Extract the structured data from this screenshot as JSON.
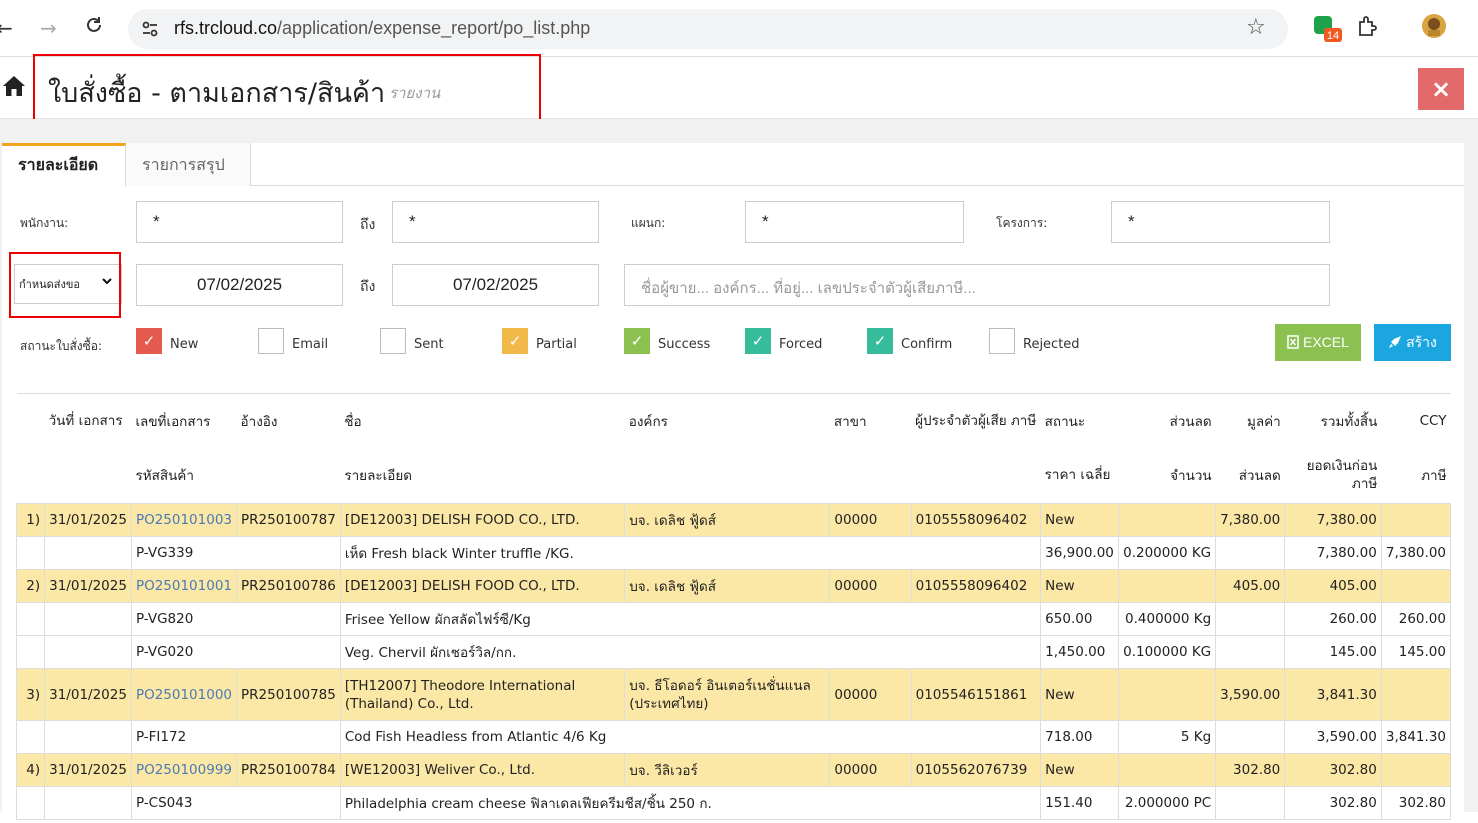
{
  "browser": {
    "url_domain": "rfs.trcloud.co",
    "url_path": "/application/expense_report/po_list.php",
    "ext_badge": "14"
  },
  "page": {
    "title": "ใบสั่งซื้อ - ตามเอกสาร/สินค้า",
    "subtitle": "รายงาน",
    "close_label": "×"
  },
  "tabs": [
    "รายละเอียด",
    "รายการสรุป"
  ],
  "filters": {
    "employee_label": "พนักงาน:",
    "employee_value": "*",
    "to_label_1": "ถึง",
    "employee_to_value": "*",
    "dept_label": "แผนก:",
    "dept_value": "*",
    "project_label": "โครงการ:",
    "project_value": "*",
    "date_type": "กำหนดส่งขอ",
    "date_from": "07/02/2025",
    "to_label_2": "ถึง",
    "date_to": "07/02/2025",
    "search_placeholder": "ชื่อผู้ขาย... องค์กร... ที่อยู่... เลขประจำตัวผู้เสียภาษี...",
    "status_label": "สถานะใบสั่งซื้อ:"
  },
  "statuses": [
    {
      "label": "New",
      "checked": true,
      "color": "#e55a4e"
    },
    {
      "label": "Email",
      "checked": false,
      "color": "#ffffff"
    },
    {
      "label": "Sent",
      "checked": false,
      "color": "#ffffff"
    },
    {
      "label": "Partial",
      "checked": true,
      "color": "#f0b94a"
    },
    {
      "label": "Success",
      "checked": true,
      "color": "#8cc152"
    },
    {
      "label": "Forced",
      "checked": true,
      "color": "#37bc9b"
    },
    {
      "label": "Confirm",
      "checked": true,
      "color": "#37bc9b"
    },
    {
      "label": "Rejected",
      "checked": false,
      "color": "#ffffff"
    }
  ],
  "buttons": {
    "excel": "EXCEL",
    "excel_color": "#8cc152",
    "create": "สร้าง",
    "create_color": "#1ba6df"
  },
  "table": {
    "head1": [
      "วันที่ เอกสาร",
      "เลขที่เอกสาร",
      "อ้างอิง",
      "ชื่อ",
      "องค์กร",
      "สาขา",
      "ผู้ประจำตัวผู้เสีย ภาษี",
      "สถานะ",
      "ส่วนลด",
      "มูลค่า",
      "รวมทั้งสิ้น",
      "CCY"
    ],
    "head2": [
      "รหัสสินค้า",
      "รายละเอียด",
      "ราคา เฉลี่ย",
      "จำนวน",
      "ส่วนลด",
      "ยอดเงินก่อน ภาษี",
      "ภาษี"
    ],
    "rows": [
      {
        "type": "po",
        "no": "1)",
        "date": "31/01/2025",
        "doc": "PO250101003",
        "ref": "PR250100787",
        "name": "[DE12003] DELISH FOOD CO., LTD.",
        "org": "บจ. เดลิช ฟู้ดส์",
        "branch": "00000",
        "tax": "0105558096402",
        "status": "New",
        "discount": "",
        "value": "7,380.00",
        "total": "7,380.00",
        "ccy": ""
      },
      {
        "type": "item",
        "code": "P-VG339",
        "desc": "เห็ด Fresh black Winter truffle /KG.",
        "price": "36,900.00",
        "qty": "0.200000 KG",
        "disc": "",
        "pretax": "7,380.00",
        "tax": "7,380.00"
      },
      {
        "type": "po",
        "no": "2)",
        "date": "31/01/2025",
        "doc": "PO250101001",
        "ref": "PR250100786",
        "name": "[DE12003] DELISH FOOD CO., LTD.",
        "org": "บจ. เดลิช ฟู้ดส์",
        "branch": "00000",
        "tax": "0105558096402",
        "status": "New",
        "discount": "",
        "value": "405.00",
        "total": "405.00",
        "ccy": ""
      },
      {
        "type": "item",
        "code": "P-VG820",
        "desc": "Frisee Yellow ผักสลัดไฟร์ซี/Kg",
        "price": "650.00",
        "qty": "0.400000 Kg",
        "disc": "",
        "pretax": "260.00",
        "tax": "260.00"
      },
      {
        "type": "item",
        "code": "P-VG020",
        "desc": "Veg. Chervil ผักเชอร์วิล/กก.",
        "price": "1,450.00",
        "qty": "0.100000 KG",
        "disc": "",
        "pretax": "145.00",
        "tax": "145.00"
      },
      {
        "type": "po",
        "no": "3)",
        "date": "31/01/2025",
        "doc": "PO250101000",
        "ref": "PR250100785",
        "name": "[TH12007] Theodore International (Thailand) Co., Ltd.",
        "org": "บจ. ธีโอดอร์ อินเตอร์เนชั่นแนล (ประเทศไทย)",
        "branch": "00000",
        "tax": "0105546151861",
        "status": "New",
        "discount": "",
        "value": "3,590.00",
        "total": "3,841.30",
        "ccy": ""
      },
      {
        "type": "item",
        "code": "P-FI172",
        "desc": "Cod Fish Headless from Atlantic 4/6 Kg",
        "price": "718.00",
        "qty": "5 Kg",
        "disc": "",
        "pretax": "3,590.00",
        "tax": "3,841.30"
      },
      {
        "type": "po",
        "no": "4)",
        "date": "31/01/2025",
        "doc": "PO250100999",
        "ref": "PR250100784",
        "name": "[WE12003] Weliver Co., Ltd.",
        "org": "บจ. วีลิเวอร์",
        "branch": "00000",
        "tax": "0105562076739",
        "status": "New",
        "discount": "",
        "value": "302.80",
        "total": "302.80",
        "ccy": ""
      },
      {
        "type": "item",
        "code": "P-CS043",
        "desc": "Philadelphia cream cheese ฟิลาเดลเฟียครีมชีส/ชิ้น 250 ก.",
        "price": "151.40",
        "qty": "2.000000 PC",
        "disc": "",
        "pretax": "302.80",
        "tax": "302.80"
      }
    ]
  }
}
